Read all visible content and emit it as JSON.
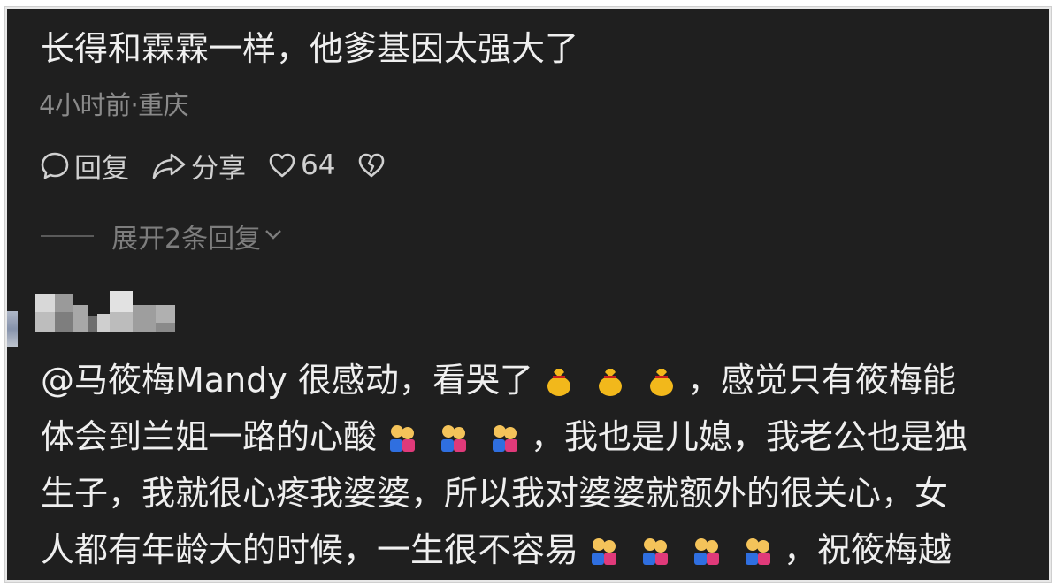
{
  "comment": {
    "text": "长得和霖霖一样，他爹基因太强大了",
    "meta": "4小时前·重庆"
  },
  "actions": {
    "reply_label": "回复",
    "share_label": "分享",
    "like_count": "64"
  },
  "expand_replies": {
    "label": "展开2条回复"
  },
  "reply": {
    "lines": {
      "l1_a": "@马筱梅Mandy 很感动，看哭了",
      "l1_b": "，感觉只有筱梅能",
      "l2_a": "体会到兰姐一路的心酸",
      "l2_b": "，我也是儿媳，我老公也是独",
      "l3": "生子，我就很心疼我婆婆，所以我对婆婆就额外的很关心，女",
      "l4_a": "人都有年龄大的时候，一生很不容易",
      "l4_b": "，祝筱梅越"
    },
    "emoji": {
      "l1": "money-bag-emoji",
      "l2": "hugging-people-emoji",
      "l4": "hugging-people-emoji"
    }
  },
  "colors": {
    "background": "#1f1f1f",
    "text": "#efefef",
    "muted": "#8a8a8a"
  }
}
